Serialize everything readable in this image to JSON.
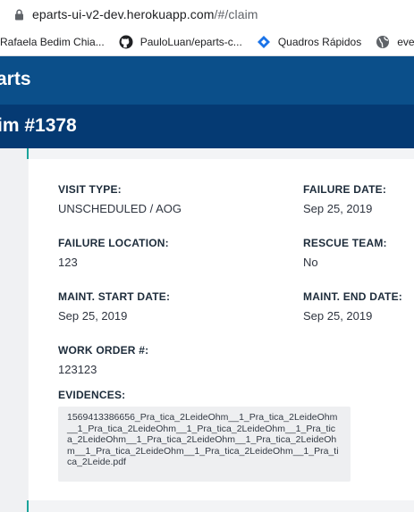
{
  "browser": {
    "url_host": "eparts-ui-v2-dev.herokuapp.com",
    "url_path": "/#/claim",
    "bookmarks": [
      {
        "label": "Rafaela Bedim Chia...",
        "icon": "none"
      },
      {
        "label": "PauloLuan/eparts-c...",
        "icon": "github-icon"
      },
      {
        "label": "Quadros Rápidos",
        "icon": "diamond-icon"
      },
      {
        "label": "ever",
        "icon": "globe-icon"
      }
    ]
  },
  "app": {
    "header_title": "arts",
    "claim_title": "im #1378"
  },
  "claim": {
    "visit_type_label": "VISIT TYPE:",
    "visit_type_value": "UNSCHEDULED / AOG",
    "failure_date_label": "FAILURE DATE:",
    "failure_date_value": "Sep 25, 2019",
    "failure_location_label": "FAILURE LOCATION:",
    "failure_location_value": "123",
    "rescue_team_label": "RESCUE TEAM:",
    "rescue_team_value": "No",
    "maint_start_label": "MAINT. START DATE:",
    "maint_start_value": "Sep 25, 2019",
    "maint_end_label": "MAINT. END DATE:",
    "maint_end_value": "Sep 25, 2019",
    "work_order_label": "WORK ORDER #:",
    "work_order_value": "123123",
    "evidences_label": "EVIDENCES:",
    "evidence_file": "1569413386656_Pra_tica_2LeideOhm__1_Pra_tica_2LeideOhm__1_Pra_tica_2LeideOhm__1_Pra_tica_2LeideOhm__1_Pra_tica_2LeideOhm__1_Pra_tica_2LeideOhm__1_Pra_tica_2LeideOhm__1_Pra_tica_2LeideOhm__1_Pra_tica_2LeideOhm__1_Pra_tica_2Leide.pdf"
  }
}
